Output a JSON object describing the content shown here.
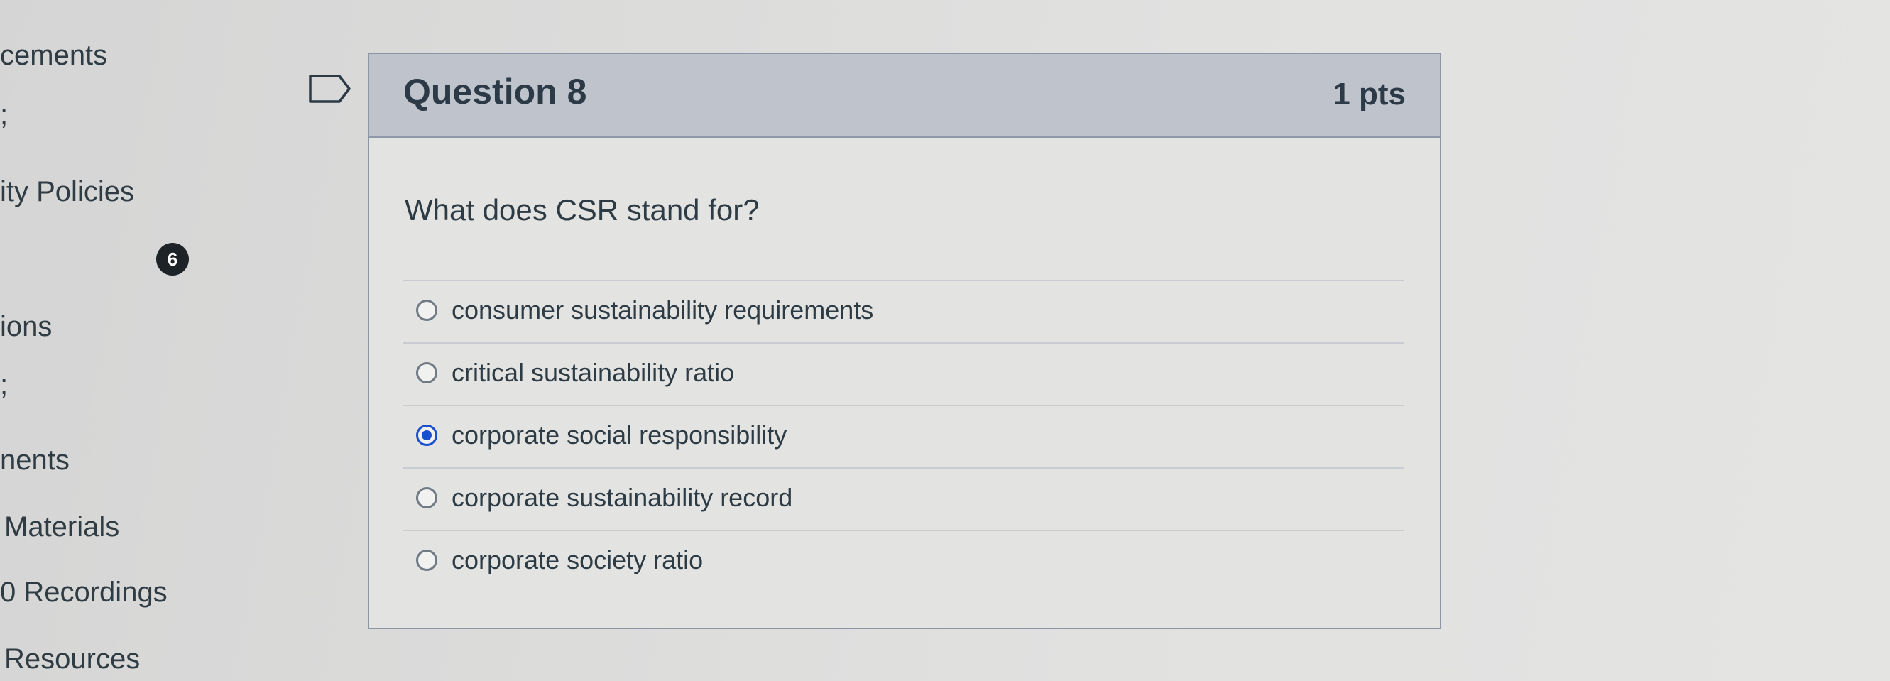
{
  "sidebar": {
    "items": [
      {
        "label": "cements"
      },
      {
        "label": "ity Policies"
      },
      {
        "label": "ions"
      },
      {
        "label": "nents"
      },
      {
        "label": "Materials"
      },
      {
        "label": "0 Recordings"
      },
      {
        "label": "Resources"
      }
    ],
    "badge_count": "6"
  },
  "question": {
    "title": "Question 8",
    "points": "1 pts",
    "text": "What does CSR stand for?",
    "answers": [
      {
        "label": "consumer sustainability requirements",
        "selected": false
      },
      {
        "label": "critical sustainability ratio",
        "selected": false
      },
      {
        "label": "corporate social responsibility",
        "selected": true
      },
      {
        "label": "corporate sustainability record",
        "selected": false
      },
      {
        "label": "corporate society ratio",
        "selected": false
      }
    ]
  },
  "colors": {
    "header_bg": "#bfc4cc",
    "selected_radio": "#1a4fd0",
    "badge_bg": "#1d2327"
  },
  "icons": {
    "flag": "flag-icon"
  }
}
